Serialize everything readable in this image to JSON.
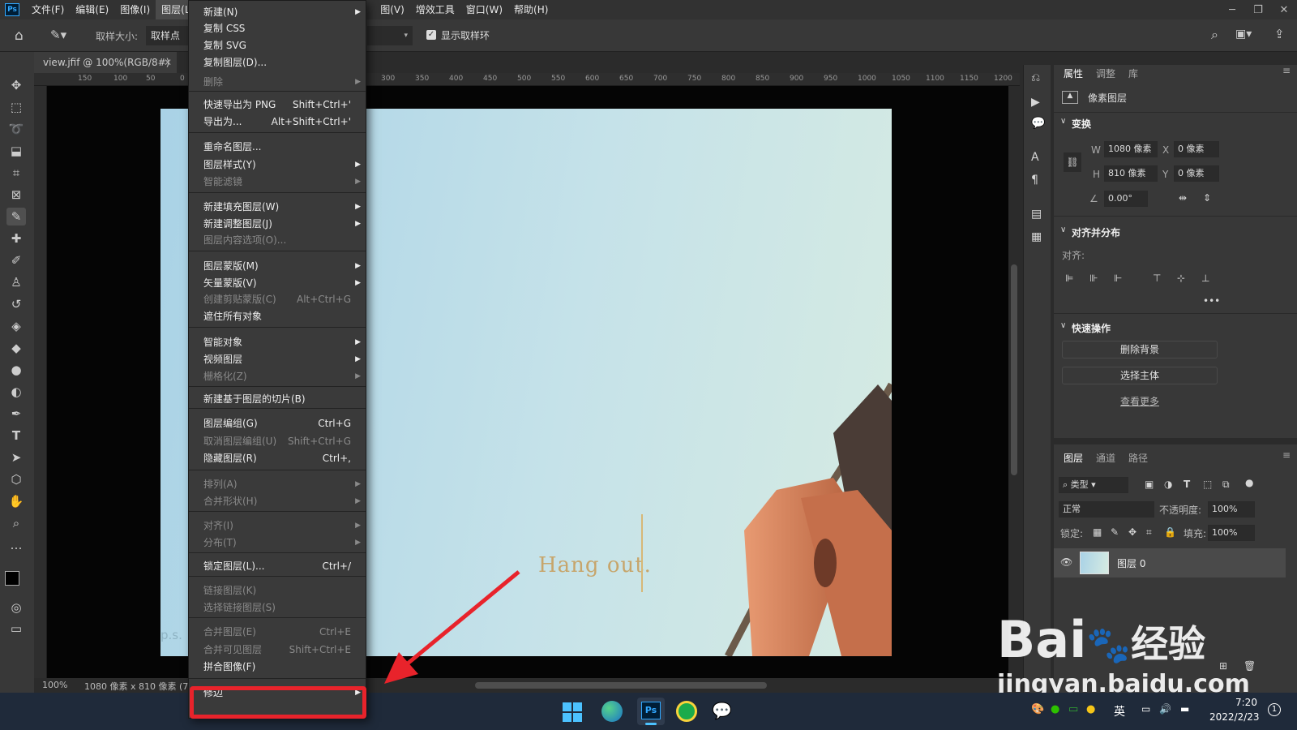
{
  "app": {
    "logo": "Ps"
  },
  "menubar": {
    "items": [
      "文件(F)",
      "编辑(E)",
      "图像(I)",
      "图层(L)"
    ],
    "items_right": [
      "图(V)",
      "增效工具",
      "窗口(W)",
      "帮助(H)"
    ]
  },
  "options_bar": {
    "sample_size_label": "取样大小:",
    "sample_size_value": "取样点",
    "show_ring_label": "显示取样环",
    "show_ring_checked": true
  },
  "document": {
    "tab_title": "view.jfif @ 100%(RGB/8#)",
    "zoom": "100%",
    "dimensions": "1080 像素 x 810 像素 (7",
    "photo_text": "Hang out.",
    "photo_corner_text": "p.s."
  },
  "ruler_ticks": [
    "150",
    "100",
    "50",
    "0",
    "300",
    "350",
    "400",
    "450",
    "500",
    "550",
    "600",
    "650",
    "700",
    "750",
    "800",
    "850",
    "900",
    "950",
    "1000",
    "1050",
    "1100",
    "1150",
    "1200"
  ],
  "layer_menu": {
    "items": [
      {
        "label": "新建(N)",
        "shortcut": "",
        "submenu": true,
        "disabled": false
      },
      {
        "label": "复制 CSS",
        "shortcut": "",
        "submenu": false,
        "disabled": false
      },
      {
        "label": "复制 SVG",
        "shortcut": "",
        "submenu": false,
        "disabled": false
      },
      {
        "label": "复制图层(D)...",
        "shortcut": "",
        "submenu": false,
        "disabled": false
      },
      {
        "label": "删除",
        "shortcut": "",
        "submenu": true,
        "disabled": true
      },
      {
        "label": "快速导出为 PNG",
        "shortcut": "Shift+Ctrl+'",
        "submenu": false,
        "disabled": false
      },
      {
        "label": "导出为...",
        "shortcut": "Alt+Shift+Ctrl+'",
        "submenu": false,
        "disabled": false
      },
      {
        "label": "重命名图层...",
        "shortcut": "",
        "submenu": false,
        "disabled": false
      },
      {
        "label": "图层样式(Y)",
        "shortcut": "",
        "submenu": true,
        "disabled": false
      },
      {
        "label": "智能滤镜",
        "shortcut": "",
        "submenu": true,
        "disabled": true
      },
      {
        "label": "新建填充图层(W)",
        "shortcut": "",
        "submenu": true,
        "disabled": false
      },
      {
        "label": "新建调整图层(J)",
        "shortcut": "",
        "submenu": true,
        "disabled": false
      },
      {
        "label": "图层内容选项(O)...",
        "shortcut": "",
        "submenu": false,
        "disabled": true
      },
      {
        "label": "图层蒙版(M)",
        "shortcut": "",
        "submenu": true,
        "disabled": false
      },
      {
        "label": "矢量蒙版(V)",
        "shortcut": "",
        "submenu": true,
        "disabled": false
      },
      {
        "label": "创建剪贴蒙版(C)",
        "shortcut": "Alt+Ctrl+G",
        "submenu": false,
        "disabled": true
      },
      {
        "label": "遮住所有对象",
        "shortcut": "",
        "submenu": false,
        "disabled": false
      },
      {
        "label": "智能对象",
        "shortcut": "",
        "submenu": true,
        "disabled": false
      },
      {
        "label": "视频图层",
        "shortcut": "",
        "submenu": true,
        "disabled": false
      },
      {
        "label": "栅格化(Z)",
        "shortcut": "",
        "submenu": true,
        "disabled": true
      },
      {
        "label": "新建基于图层的切片(B)",
        "shortcut": "",
        "submenu": false,
        "disabled": false
      },
      {
        "label": "图层编组(G)",
        "shortcut": "Ctrl+G",
        "submenu": false,
        "disabled": false
      },
      {
        "label": "取消图层编组(U)",
        "shortcut": "Shift+Ctrl+G",
        "submenu": false,
        "disabled": true
      },
      {
        "label": "隐藏图层(R)",
        "shortcut": "Ctrl+,",
        "submenu": false,
        "disabled": false
      },
      {
        "label": "排列(A)",
        "shortcut": "",
        "submenu": true,
        "disabled": true
      },
      {
        "label": "合并形状(H)",
        "shortcut": "",
        "submenu": true,
        "disabled": true
      },
      {
        "label": "对齐(I)",
        "shortcut": "",
        "submenu": true,
        "disabled": true
      },
      {
        "label": "分布(T)",
        "shortcut": "",
        "submenu": true,
        "disabled": true
      },
      {
        "label": "锁定图层(L)...",
        "shortcut": "Ctrl+/",
        "submenu": false,
        "disabled": false
      },
      {
        "label": "链接图层(K)",
        "shortcut": "",
        "submenu": false,
        "disabled": true
      },
      {
        "label": "选择链接图层(S)",
        "shortcut": "",
        "submenu": false,
        "disabled": true
      },
      {
        "label": "合并图层(E)",
        "shortcut": "Ctrl+E",
        "submenu": false,
        "disabled": true
      },
      {
        "label": "合并可见图层",
        "shortcut": "Shift+Ctrl+E",
        "submenu": false,
        "disabled": true
      },
      {
        "label": "拼合图像(F)",
        "shortcut": "",
        "submenu": false,
        "disabled": false
      },
      {
        "label": "修边",
        "shortcut": "",
        "submenu": true,
        "disabled": false
      }
    ]
  },
  "properties_panel": {
    "tabs": [
      "属性",
      "调整",
      "库"
    ],
    "layer_type": "像素图层",
    "transform": {
      "title": "变换",
      "w_label": "W",
      "w_value": "1080 像素",
      "x_label": "X",
      "x_value": "0 像素",
      "h_label": "H",
      "h_value": "810 像素",
      "y_label": "Y",
      "y_value": "0 像素",
      "angle": "0.00°"
    },
    "align": {
      "title": "对齐并分布",
      "label": "对齐:"
    },
    "quick_actions": {
      "title": "快速操作",
      "remove_bg": "删除背景",
      "select_subject": "选择主体",
      "more": "查看更多"
    }
  },
  "layers_panel": {
    "tabs": [
      "图层",
      "通道",
      "路径"
    ],
    "filter_kind": "类型",
    "blend_mode": "正常",
    "opacity_label": "不透明度:",
    "opacity_value": "100%",
    "lock_label": "锁定:",
    "fill_label": "填充:",
    "fill_value": "100%",
    "layers": [
      {
        "name": "图层 0",
        "visible": true
      }
    ]
  },
  "taskbar": {
    "lang": "英",
    "time": "7:20",
    "date": "2022/2/23",
    "notification_count": "1",
    "ps_label": "Ps"
  },
  "watermark": {
    "brand": "Bai",
    "brand2": "经验",
    "url": "jingyan.baidu.com"
  },
  "colors": {
    "highlight_red": "#e8232b",
    "ps_blue": "#31a8ff"
  }
}
